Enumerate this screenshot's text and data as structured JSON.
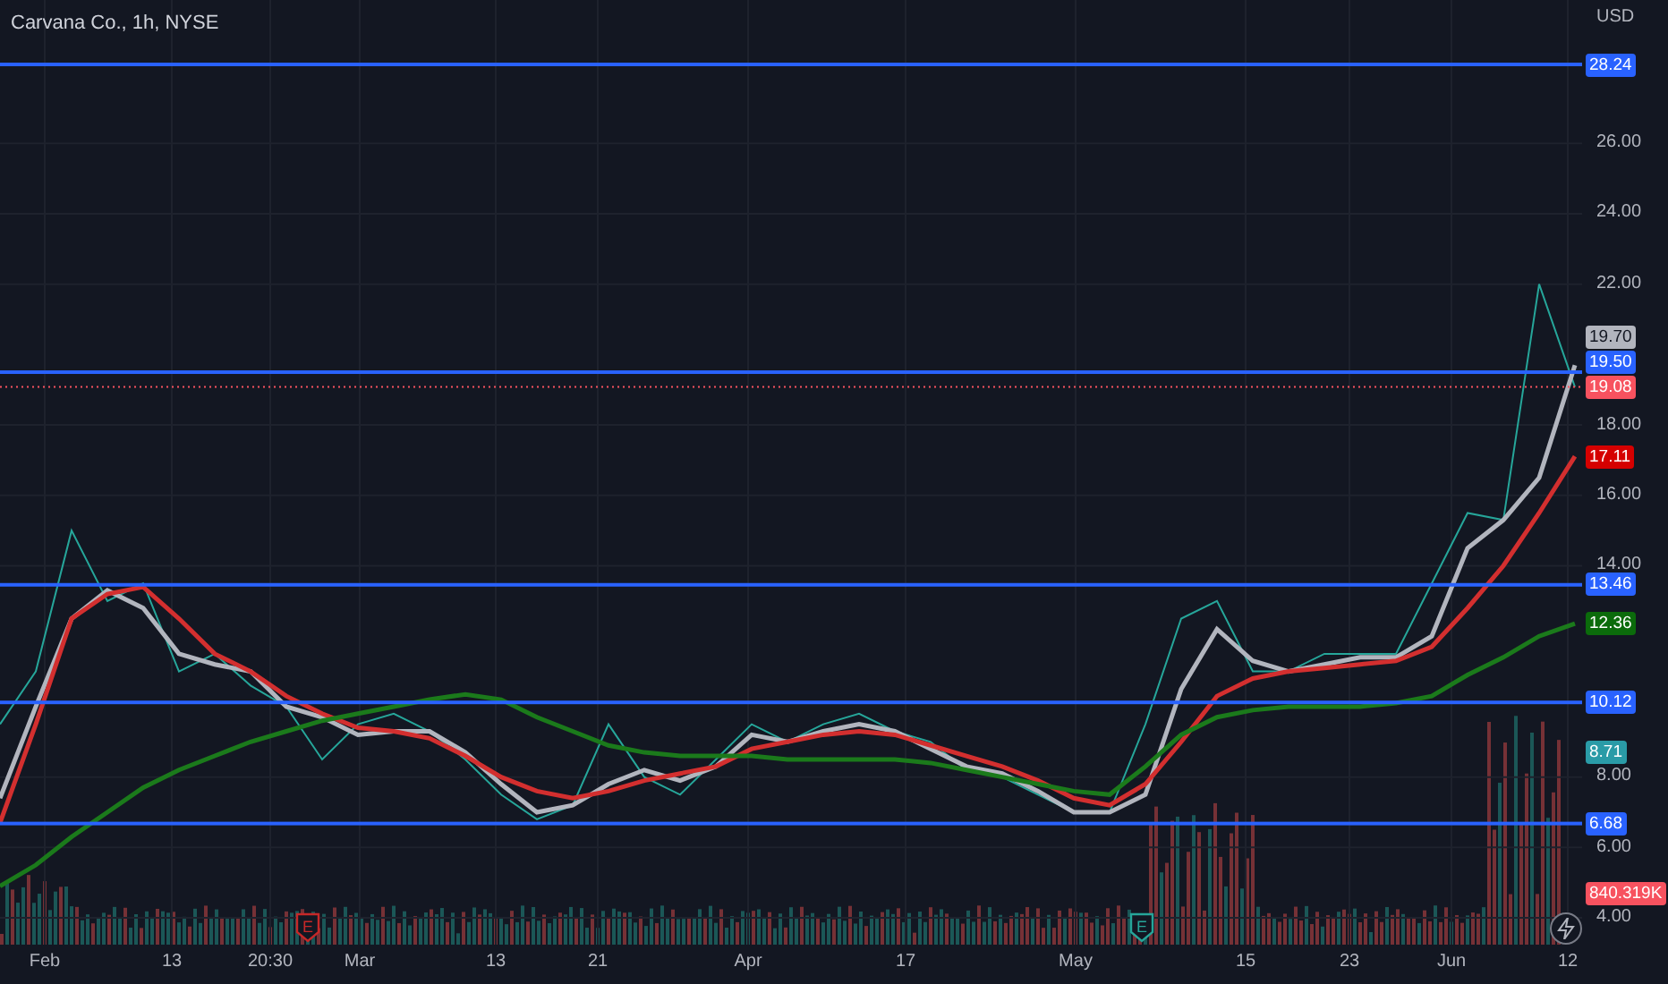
{
  "symbol": {
    "title": "Carvana Co., 1h, NYSE"
  },
  "price_axis": {
    "currency": "USD"
  },
  "chart_data": {
    "type": "line",
    "ylim": [
      3.24,
      30.07
    ],
    "grid": true,
    "series": [
      {
        "color": "#26a69a",
        "values": [
          9.5,
          11,
          15,
          13,
          13.5,
          11,
          11.5,
          10.6,
          10,
          8.5,
          9.5,
          9.8,
          9.3,
          8.5,
          7.5,
          6.8,
          7.2,
          9.5,
          8,
          7.5,
          8.5,
          9.5,
          9,
          9.5,
          9.8,
          9.3,
          9,
          8.2,
          8,
          7.5,
          7,
          7,
          9.5,
          12.5,
          13,
          11,
          11,
          11.5,
          11.5,
          11.5,
          13.5,
          15.5,
          15.3,
          22,
          19.08
        ]
      },
      {
        "color": "#b2b5be",
        "values": [
          7.4,
          10,
          12.5,
          13.3,
          12.8,
          11.5,
          11.2,
          11,
          10.0,
          9.7,
          9.2,
          9.3,
          9.3,
          8.7,
          7.8,
          7,
          7.2,
          7.8,
          8.2,
          7.9,
          8.3,
          9.2,
          9,
          9.3,
          9.5,
          9.3,
          8.8,
          8.3,
          8.1,
          7.6,
          7,
          7,
          7.5,
          10.5,
          12.2,
          11.3,
          11,
          11.2,
          11.4,
          11.4,
          12,
          14.5,
          15.3,
          16.5,
          19.7
        ]
      },
      {
        "color": "#d32f2f",
        "values": [
          6.7,
          9.5,
          12.5,
          13.2,
          13.4,
          12.5,
          11.5,
          11,
          10.3,
          9.8,
          9.4,
          9.3,
          9.1,
          8.6,
          8,
          7.6,
          7.4,
          7.6,
          7.9,
          8.1,
          8.3,
          8.8,
          9,
          9.2,
          9.3,
          9.2,
          8.9,
          8.6,
          8.3,
          7.9,
          7.4,
          7.2,
          7.8,
          9,
          10.3,
          10.8,
          11,
          11.1,
          11.2,
          11.3,
          11.7,
          12.8,
          14,
          15.5,
          17.11
        ]
      },
      {
        "color": "#1b7a1b",
        "values": [
          4.9,
          5.5,
          6.3,
          7,
          7.7,
          8.2,
          8.6,
          9,
          9.3,
          9.6,
          9.8,
          10,
          10.2,
          10.35,
          10.2,
          9.7,
          9.3,
          8.9,
          8.7,
          8.6,
          8.6,
          8.6,
          8.5,
          8.5,
          8.5,
          8.5,
          8.4,
          8.2,
          8,
          7.8,
          7.6,
          7.5,
          8.3,
          9.2,
          9.7,
          9.9,
          10,
          10,
          10,
          10.1,
          10.3,
          10.9,
          11.4,
          12,
          12.36
        ]
      }
    ],
    "yticks": [
      {
        "value": 26,
        "label": "26.00"
      },
      {
        "value": 24,
        "label": "24.00"
      },
      {
        "value": 22,
        "label": "22.00"
      },
      {
        "value": 18,
        "label": "18.00"
      },
      {
        "value": 16,
        "label": "16.00"
      },
      {
        "value": 14,
        "label": "14.00"
      },
      {
        "value": 8,
        "label": "8.00"
      },
      {
        "value": 6,
        "label": "6.00"
      },
      {
        "value": 4,
        "label": "4.00"
      }
    ]
  },
  "time_axis": [
    "Feb",
    "13",
    "20:30",
    "Mar",
    "13",
    "21",
    "Apr",
    "17",
    "May",
    "15",
    "23",
    "Jun",
    "12"
  ],
  "events": [
    {
      "label": "E",
      "color": "#c62828"
    },
    {
      "label": "E",
      "color": "#26a69a"
    }
  ],
  "price_tags": [
    {
      "kind": "level",
      "label": "28.24",
      "color": "#2962ff"
    },
    {
      "kind": "ma",
      "label": "19.70",
      "color": "#b2b5be"
    },
    {
      "kind": "level",
      "label": "19.50",
      "color": "#2962ff"
    },
    {
      "kind": "last",
      "label": "19.08",
      "color": "#f7525f"
    },
    {
      "kind": "ma",
      "label": "17.11",
      "color": "#d50000"
    },
    {
      "kind": "level",
      "label": "13.46",
      "color": "#2962ff"
    },
    {
      "kind": "ma",
      "label": "12.36",
      "color": "#0b6b0b"
    },
    {
      "kind": "level",
      "label": "10.12",
      "color": "#2962ff"
    },
    {
      "kind": "ma",
      "label": "8.71",
      "color": "#2a9ba7"
    },
    {
      "kind": "level",
      "label": "6.68",
      "color": "#2962ff"
    },
    {
      "kind": "volume",
      "label": "840.319K",
      "color": "#f7525f"
    }
  ]
}
